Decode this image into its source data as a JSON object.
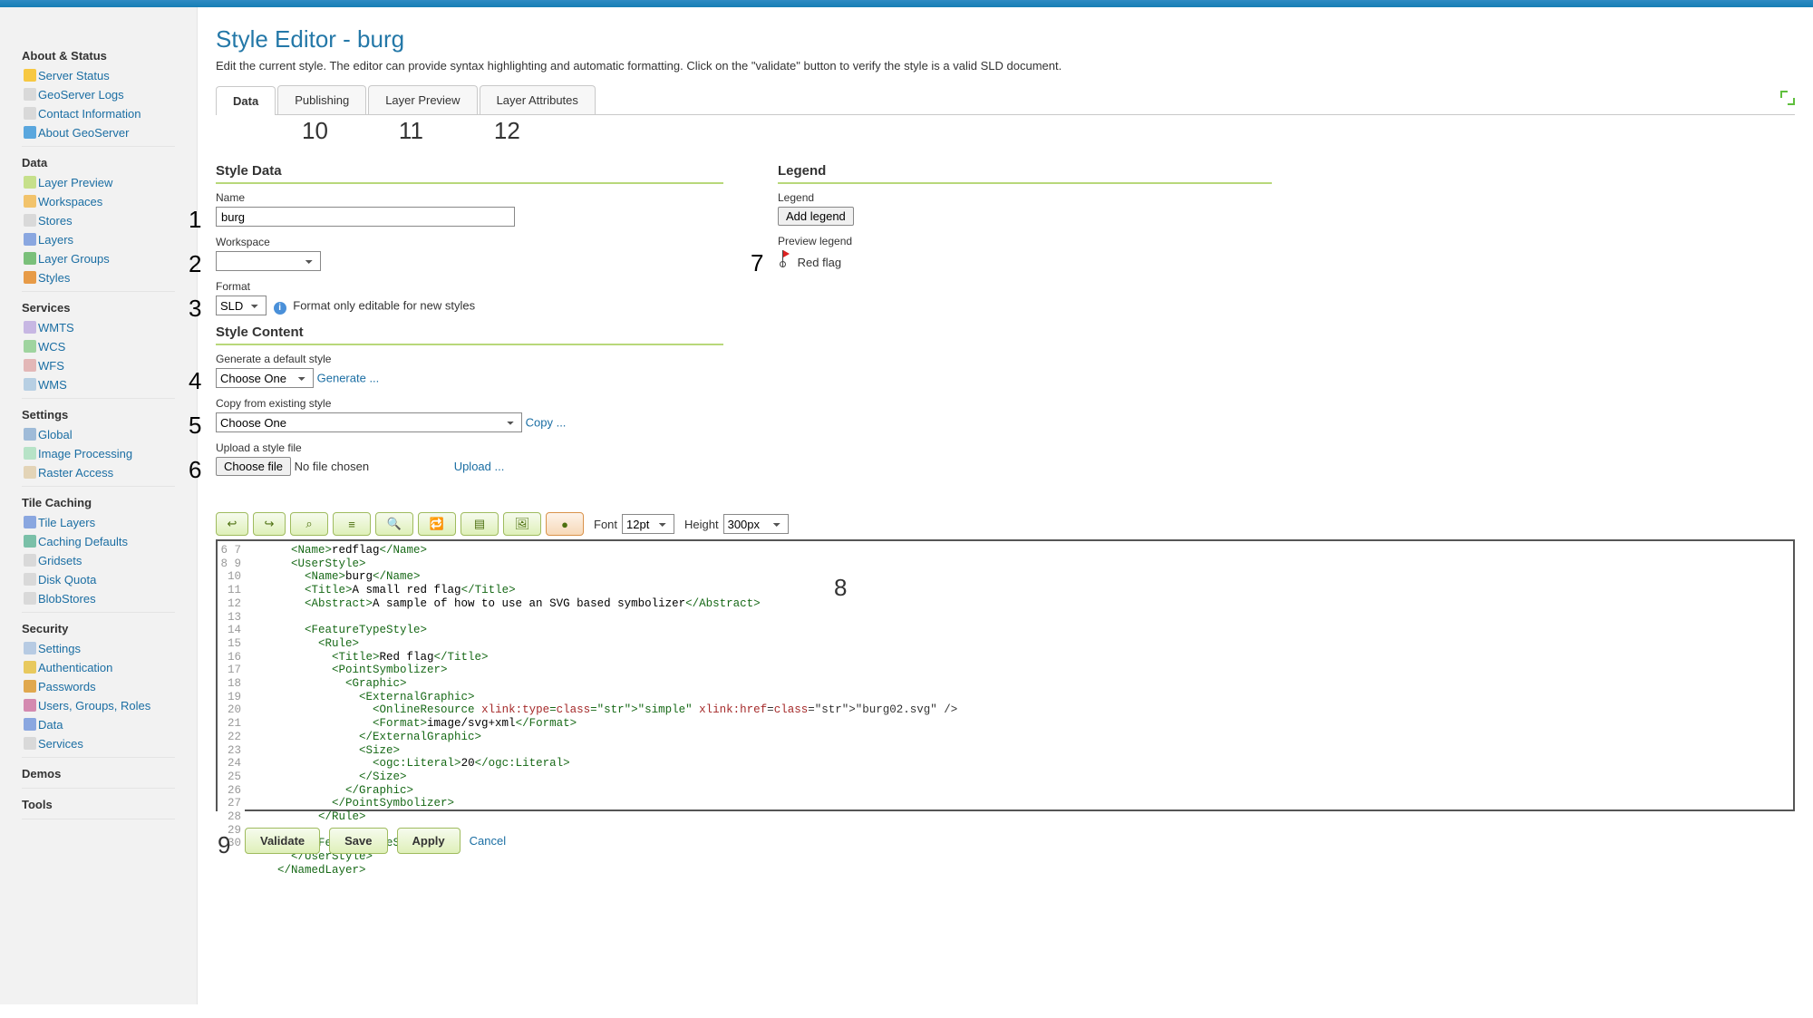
{
  "title": "Style Editor - burg",
  "subtitle": "Edit the current style. The editor can provide syntax highlighting and automatic formatting. Click on the \"validate\" button to verify the style is a valid SLD document.",
  "tabs": {
    "data": "Data",
    "publishing": "Publishing",
    "layer_preview": "Layer Preview",
    "layer_attributes": "Layer Attributes"
  },
  "callouts": {
    "c1": "1",
    "c2": "2",
    "c3": "3",
    "c4": "4",
    "c5": "5",
    "c6": "6",
    "c7": "7",
    "c8": "8",
    "c9": "9",
    "c10": "10",
    "c11": "11",
    "c12": "12"
  },
  "section_style_data": "Style Data",
  "section_style_content": "Style Content",
  "section_legend": "Legend",
  "fields": {
    "name_label": "Name",
    "name_value": "burg",
    "workspace_label": "Workspace",
    "workspace_value": "",
    "format_label": "Format",
    "format_value": "SLD",
    "format_note": "Format only editable for new styles",
    "gen_label": "Generate a default style",
    "gen_value": "Choose One",
    "gen_link": "Generate ...",
    "copy_label": "Copy from existing style",
    "copy_value": "Choose One",
    "copy_link": "Copy ...",
    "upload_label": "Upload a style file",
    "choose_file_btn": "Choose file",
    "no_file": "No file chosen",
    "upload_link": "Upload ..."
  },
  "legend": {
    "label": "Legend",
    "add_btn": "Add legend",
    "preview_label": "Preview legend",
    "preview_text": "Red flag"
  },
  "toolbar": {
    "undo": "↩",
    "redo": "↪",
    "goto": "⌕",
    "reformat": "≡",
    "find": "🔍",
    "findrepl": "🔁",
    "insert": "▤",
    "image": "🖼",
    "color": "●",
    "font_label": "Font",
    "font_value": "12pt",
    "height_label": "Height",
    "height_value": "300px"
  },
  "editor": {
    "line_start": 6,
    "line_end": 30,
    "lines": [
      "      <Name>redflag</Name>",
      "      <UserStyle>",
      "        <Name>burg</Name>",
      "        <Title>A small red flag</Title>",
      "        <Abstract>A sample of how to use an SVG based symbolizer</Abstract>",
      "",
      "        <FeatureTypeStyle>",
      "          <Rule>",
      "            <Title>Red flag</Title>",
      "            <PointSymbolizer>",
      "              <Graphic>",
      "                <ExternalGraphic>",
      "                  <OnlineResource xlink:type=\"simple\" xlink:href=\"burg02.svg\" />",
      "                  <Format>image/svg+xml</Format>",
      "                </ExternalGraphic>",
      "                <Size>",
      "                  <ogc:Literal>20</ogc:Literal>",
      "                </Size>",
      "              </Graphic>",
      "            </PointSymbolizer>",
      "          </Rule>",
      "",
      "        </FeatureTypeStyle>",
      "      </UserStyle>",
      "    </NamedLayer>"
    ]
  },
  "actions": {
    "validate": "Validate",
    "save": "Save",
    "apply": "Apply",
    "cancel": "Cancel"
  },
  "sidebar": {
    "groups": [
      {
        "title": "About & Status",
        "items": [
          {
            "label": "Server Status",
            "c": "#f7c842"
          },
          {
            "label": "GeoServer Logs",
            "c": "#d9d9d9"
          },
          {
            "label": "Contact Information",
            "c": "#d9d9d9"
          },
          {
            "label": "About GeoServer",
            "c": "#5aa7de"
          }
        ]
      },
      {
        "title": "Data",
        "items": [
          {
            "label": "Layer Preview",
            "c": "#c6e08b"
          },
          {
            "label": "Workspaces",
            "c": "#f2c36b"
          },
          {
            "label": "Stores",
            "c": "#d9d9d9"
          },
          {
            "label": "Layers",
            "c": "#8aa7e0"
          },
          {
            "label": "Layer Groups",
            "c": "#7ac07a"
          },
          {
            "label": "Styles",
            "c": "#e79b47"
          }
        ]
      },
      {
        "title": "Services",
        "items": [
          {
            "label": "WMTS",
            "c": "#c7b7e3"
          },
          {
            "label": "WCS",
            "c": "#9fd49f"
          },
          {
            "label": "WFS",
            "c": "#e3b7b7"
          },
          {
            "label": "WMS",
            "c": "#b7cfe3"
          }
        ]
      },
      {
        "title": "Settings",
        "items": [
          {
            "label": "Global",
            "c": "#9fbbd8"
          },
          {
            "label": "Image Processing",
            "c": "#b7e3c7"
          },
          {
            "label": "Raster Access",
            "c": "#e3d4b7"
          }
        ]
      },
      {
        "title": "Tile Caching",
        "items": [
          {
            "label": "Tile Layers",
            "c": "#8aa7e0"
          },
          {
            "label": "Caching Defaults",
            "c": "#7ac0a8"
          },
          {
            "label": "Gridsets",
            "c": "#d9d9d9"
          },
          {
            "label": "Disk Quota",
            "c": "#d9d9d9"
          },
          {
            "label": "BlobStores",
            "c": "#d9d9d9"
          }
        ]
      },
      {
        "title": "Security",
        "items": [
          {
            "label": "Settings",
            "c": "#b7cbe3"
          },
          {
            "label": "Authentication",
            "c": "#e8c95e"
          },
          {
            "label": "Passwords",
            "c": "#e0a84e"
          },
          {
            "label": "Users, Groups, Roles",
            "c": "#d48ab0"
          },
          {
            "label": "Data",
            "c": "#8aa7e0"
          },
          {
            "label": "Services",
            "c": "#d9d9d9"
          }
        ]
      },
      {
        "title": "Demos",
        "items": []
      },
      {
        "title": "Tools",
        "items": []
      }
    ]
  }
}
